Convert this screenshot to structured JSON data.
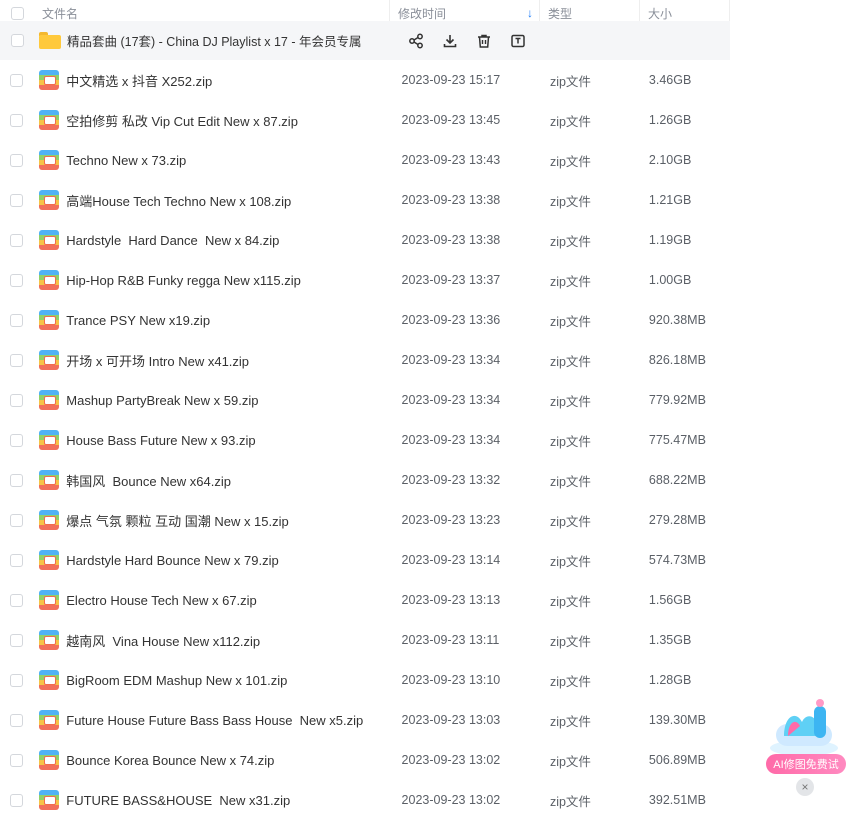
{
  "header": {
    "name": "文件名",
    "time": "修改时间",
    "type": "类型",
    "size": "大小",
    "sort_arrow": "↓"
  },
  "folder_row": {
    "name": "精品套曲 (17套) - China DJ Playlist x 17 - 年会员专属",
    "icon": "folder-icon",
    "actions": [
      "share-icon",
      "download-icon",
      "delete-icon",
      "rename-icon"
    ]
  },
  "files": [
    {
      "name": "中文精选 x 抖音 X252.zip",
      "time": "2023-09-23 15:17",
      "type": "zip文件",
      "size": "3.46GB"
    },
    {
      "name": "空拍修剪 私改 Vip Cut Edit New x 87.zip",
      "time": "2023-09-23 13:45",
      "type": "zip文件",
      "size": "1.26GB"
    },
    {
      "name": "Techno New x 73.zip",
      "time": "2023-09-23 13:43",
      "type": "zip文件",
      "size": "2.10GB"
    },
    {
      "name": "高端House Tech Techno New x 108.zip",
      "time": "2023-09-23 13:38",
      "type": "zip文件",
      "size": "1.21GB"
    },
    {
      "name": "Hardstyle  Hard Dance  New x 84.zip",
      "time": "2023-09-23 13:38",
      "type": "zip文件",
      "size": "1.19GB"
    },
    {
      "name": "Hip-Hop R&B Funky regga New x115.zip",
      "time": "2023-09-23 13:37",
      "type": "zip文件",
      "size": "1.00GB"
    },
    {
      "name": "Trance PSY New x19.zip",
      "time": "2023-09-23 13:36",
      "type": "zip文件",
      "size": "920.38MB"
    },
    {
      "name": "开场 x 可开场 Intro New x41.zip",
      "time": "2023-09-23 13:34",
      "type": "zip文件",
      "size": "826.18MB"
    },
    {
      "name": "Mashup PartyBreak New x 59.zip",
      "time": "2023-09-23 13:34",
      "type": "zip文件",
      "size": "779.92MB"
    },
    {
      "name": "House Bass Future New x 93.zip",
      "time": "2023-09-23 13:34",
      "type": "zip文件",
      "size": "775.47MB"
    },
    {
      "name": "韩国风  Bounce New x64.zip",
      "time": "2023-09-23 13:32",
      "type": "zip文件",
      "size": "688.22MB"
    },
    {
      "name": "爆点 气氛 颗粒 互动 国潮 New x 15.zip",
      "time": "2023-09-23 13:23",
      "type": "zip文件",
      "size": "279.28MB"
    },
    {
      "name": "Hardstyle Hard Bounce New x 79.zip",
      "time": "2023-09-23 13:14",
      "type": "zip文件",
      "size": "574.73MB"
    },
    {
      "name": "Electro House Tech New x 67.zip",
      "time": "2023-09-23 13:13",
      "type": "zip文件",
      "size": "1.56GB"
    },
    {
      "name": "越南风  Vina House New x112.zip",
      "time": "2023-09-23 13:11",
      "type": "zip文件",
      "size": "1.35GB"
    },
    {
      "name": "BigRoom EDM Mashup New x 101.zip",
      "time": "2023-09-23 13:10",
      "type": "zip文件",
      "size": "1.28GB"
    },
    {
      "name": "Future House Future Bass Bass House  New x5.zip",
      "time": "2023-09-23 13:03",
      "type": "zip文件",
      "size": "139.30MB"
    },
    {
      "name": "Bounce Korea Bounce New x 74.zip",
      "time": "2023-09-23 13:02",
      "type": "zip文件",
      "size": "506.89MB"
    },
    {
      "name": "FUTURE BASS&HOUSE  New x31.zip",
      "time": "2023-09-23 13:02",
      "type": "zip文件",
      "size": "392.51MB"
    }
  ],
  "ai_widget": {
    "label": "AI修图免费试",
    "close": "×"
  },
  "colors": {
    "accent": "#1e7cf7",
    "hover_row": "#f5f6f8",
    "ai_pink": "#ff6aa8"
  }
}
